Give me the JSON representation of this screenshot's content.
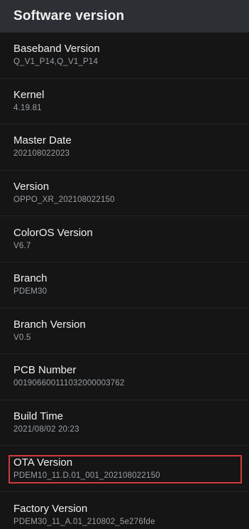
{
  "header": {
    "title": "Software version"
  },
  "items": [
    {
      "label": "Baseband Version",
      "value": "Q_V1_P14,Q_V1_P14"
    },
    {
      "label": "Kernel",
      "value": "4.19.81"
    },
    {
      "label": "Master Date",
      "value": "202108022023"
    },
    {
      "label": "Version",
      "value": "OPPO_XR_202108022150"
    },
    {
      "label": "ColorOS Version",
      "value": "V6.7"
    },
    {
      "label": "Branch",
      "value": "PDEM30"
    },
    {
      "label": "Branch Version",
      "value": "V0.5"
    },
    {
      "label": "PCB Number",
      "value": "001906600111032000003762"
    },
    {
      "label": "Build Time",
      "value": "2021/08/02 20:23"
    },
    {
      "label": "OTA Version",
      "value": "PDEM10_11.D.01_001_202108022150"
    },
    {
      "label": "Factory Version",
      "value": "PDEM30_11_A.01_210802_5e276fde"
    }
  ],
  "highlight_color": "#d13b3b"
}
